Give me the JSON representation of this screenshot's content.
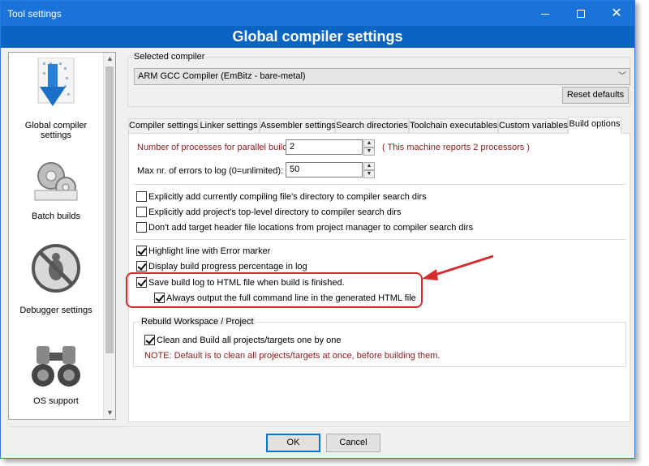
{
  "window": {
    "title": "Tool settings"
  },
  "banner": {
    "title": "Global compiler settings"
  },
  "sidebar": {
    "items": [
      {
        "label": "Global compiler settings"
      },
      {
        "label": "Batch builds"
      },
      {
        "label": "Debugger settings"
      },
      {
        "label": "OS support"
      }
    ]
  },
  "compiler": {
    "group_title": "Selected compiler",
    "selected": "ARM GCC Compiler (EmBitz - bare-metal)",
    "reset_label": "Reset defaults"
  },
  "tabs": [
    {
      "label": "Compiler settings"
    },
    {
      "label": "Linker settings"
    },
    {
      "label": "Assembler settings"
    },
    {
      "label": "Search directories"
    },
    {
      "label": "Toolchain executables"
    },
    {
      "label": "Custom variables"
    },
    {
      "label": "Build options"
    }
  ],
  "build_options": {
    "parallel_label": "Number of processes for parallel builds:",
    "parallel_value": "2",
    "machine_note": "( This machine reports 2 processors )",
    "errors_label": "Max nr. of errors to log (0=unlimited):",
    "errors_value": "50",
    "checkboxes_group1": [
      {
        "label": "Explicitly add currently compiling file's directory to compiler search dirs",
        "checked": false
      },
      {
        "label": "Explicitly add project's top-level directory to compiler search dirs",
        "checked": false
      },
      {
        "label": "Don't add target header file locations from project manager to compiler search dirs",
        "checked": false
      }
    ],
    "checkboxes_group2": [
      {
        "label": "Highlight line with Error marker",
        "checked": true
      },
      {
        "label": "Display build progress percentage in log",
        "checked": true
      },
      {
        "label": "Save build log to HTML file when build is finished.",
        "checked": true
      },
      {
        "label": "Always output the full command line in the generated HTML file",
        "checked": true
      }
    ],
    "rebuild_group_title": "Rebuild Workspace / Project",
    "rebuild_checkbox": {
      "label": "Clean and Build all projects/targets one by one",
      "checked": true
    },
    "rebuild_note": "NOTE: Default is to clean all projects/targets at once, before building them."
  },
  "footer": {
    "ok_label": "OK",
    "cancel_label": "Cancel"
  },
  "colors": {
    "titlebar": "#1a73d9",
    "banner": "#0c64c2",
    "note_red": "#8b1a1a",
    "annotation": "#d62b2b"
  }
}
